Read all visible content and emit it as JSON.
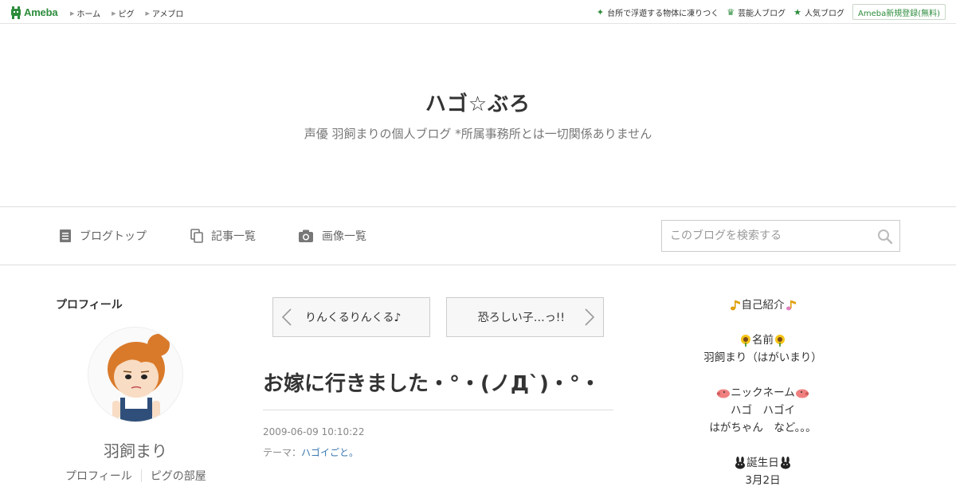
{
  "topbar": {
    "logo_text": "Ameba",
    "nav": [
      "ホーム",
      "ピグ",
      "アメブロ"
    ],
    "right_links": [
      {
        "label": "台所で浮遊する物体に凍りつく",
        "icon": "sparkle-icon"
      },
      {
        "label": "芸能人ブログ",
        "icon": "crown-icon"
      },
      {
        "label": "人気ブログ",
        "icon": "star-icon"
      }
    ],
    "register_label": "Ameba新規登録(無料)"
  },
  "header": {
    "title": "ハゴ☆ぶろ",
    "description": "声優 羽飼まりの個人ブログ *所属事務所とは一切関係ありません"
  },
  "navbar": {
    "links": [
      "ブログトップ",
      "記事一覧",
      "画像一覧"
    ],
    "search_placeholder": "このブログを検索する"
  },
  "profile": {
    "heading": "プロフィール",
    "name": "羽飼まり",
    "links": [
      "プロフィール",
      "ピグの部屋"
    ]
  },
  "entry": {
    "prev_label": "りんくるりんくる♪",
    "next_label": "恐ろしい子…っ!!",
    "title": "お嫁に行きました・°・(ノД`)・°・",
    "date": "2009-06-09 10:10:22",
    "theme_label": "テーマ：",
    "theme_value": "ハゴイごと。"
  },
  "sidebar": {
    "intro_label": "自己紹介",
    "name_label": "名前",
    "name_value": "羽飼まり（はがいまり）",
    "nick_label": "ニックネーム",
    "nick_line1": "ハゴ　ハゴイ",
    "nick_line2": "はがちゃん　など。。。",
    "birthday_label": "誕生日",
    "birthday_value": "3月2日"
  },
  "colors": {
    "ameba_green": "#2d8c3c",
    "link_blue": "#3a78b0"
  }
}
